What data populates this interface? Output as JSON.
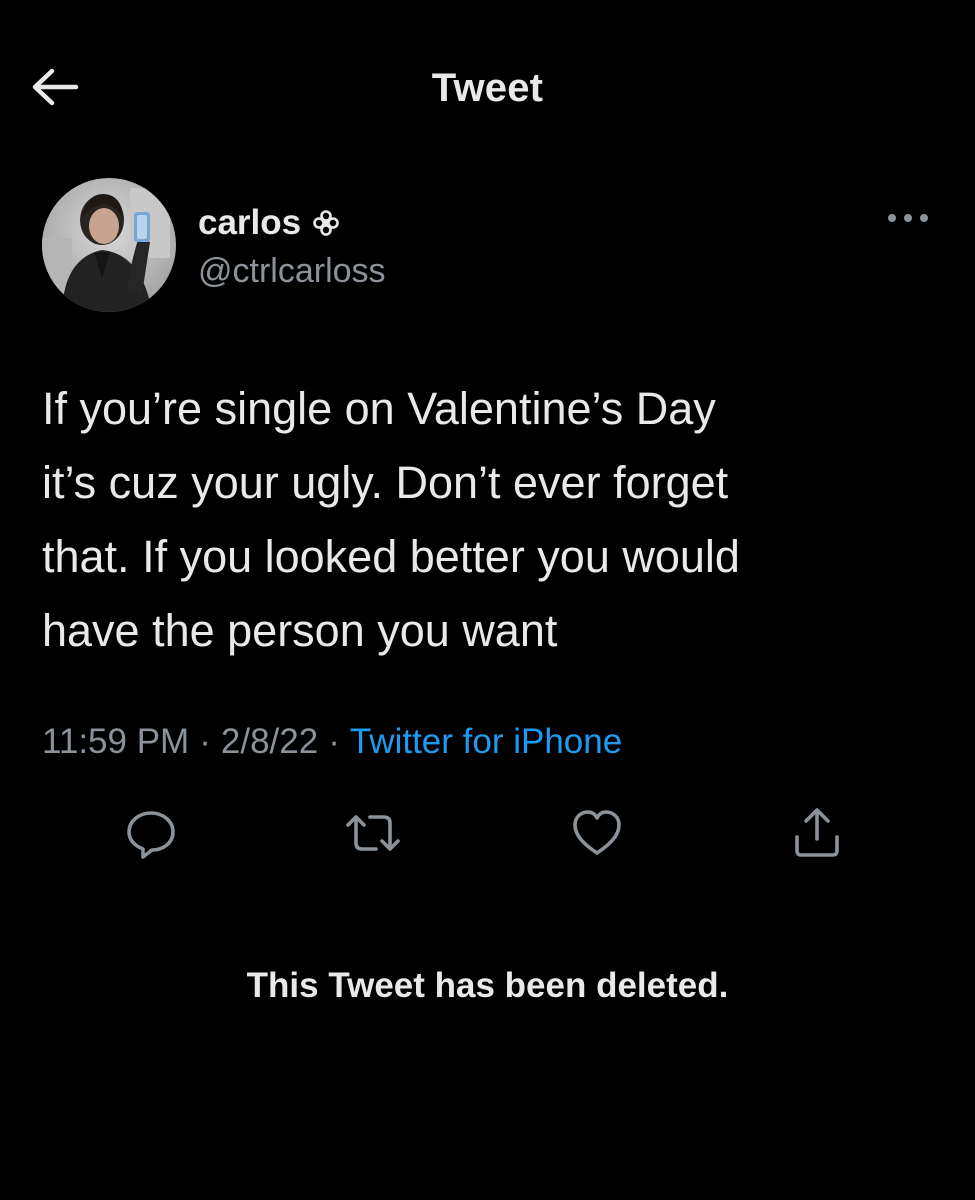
{
  "header": {
    "title": "Tweet",
    "back_icon": "arrow-left-icon"
  },
  "author": {
    "display_name": "carlos",
    "badge_icon": "flower-icon",
    "handle": "@ctrlcarloss",
    "avatar": "avatar-photo"
  },
  "tweet": {
    "text": "If you’re single on Valentine’s Day\nit’s cuz your ugly. Don’t ever forget\nthat. If you looked better you would\nhave the person you want",
    "time": "11:59 PM",
    "separator_1": "·",
    "date": "2/8/22",
    "separator_2": "·",
    "source": "Twitter for iPhone"
  },
  "actions": {
    "reply_icon": "reply-icon",
    "retweet_icon": "retweet-icon",
    "like_icon": "heart-icon",
    "share_icon": "share-icon",
    "more_icon": "more-dots-icon"
  },
  "notice": {
    "deleted": "This Tweet has been deleted."
  },
  "colors": {
    "background": "#000000",
    "primary_text": "#e7e9ea",
    "secondary_text": "#8b9299",
    "link": "#1d9bf0"
  }
}
